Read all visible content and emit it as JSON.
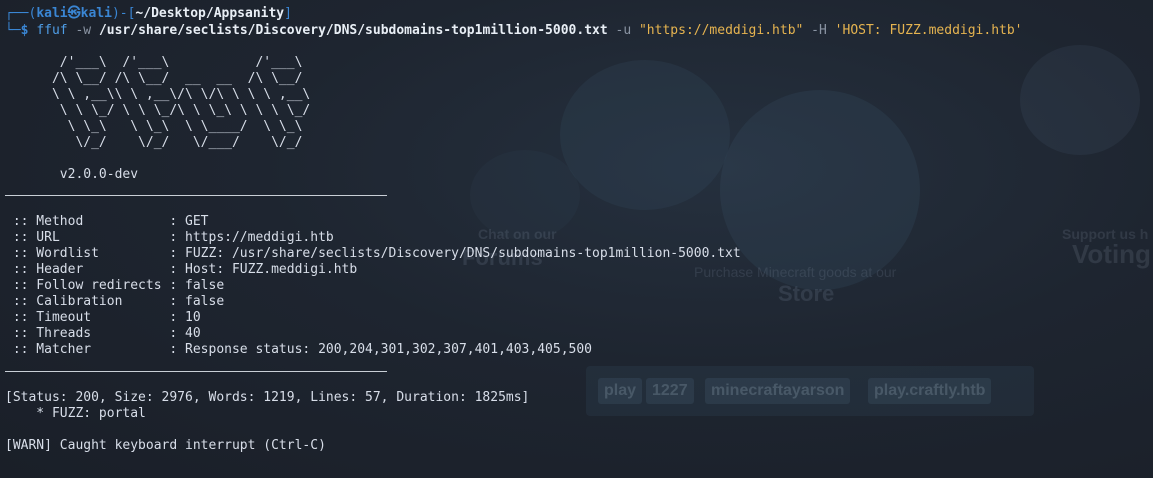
{
  "prompt": {
    "frame_top": "┌──(",
    "user": "kali㉿kali",
    "frame_mid": ")-[",
    "cwd": "~/Desktop/Appsanity",
    "frame_end": "]",
    "frame_bottom": "└─",
    "dollar": "$ "
  },
  "command": {
    "program": "ffuf",
    "flag_w": " -w ",
    "wordlist": "/usr/share/seclists/Discovery/DNS/subdomains-top1million-5000.txt",
    "flag_u": " -u ",
    "url": "\"https://meddigi.htb\"",
    "flag_h": " -H ",
    "header": "'HOST: FUZZ.meddigi.htb'"
  },
  "banner": {
    "art": [
      "       /'___\\  /'___\\           /'___\\       ",
      "      /\\ \\__/ /\\ \\__/  __  __  /\\ \\__/       ",
      "      \\ \\ ,__\\\\ \\ ,__\\/\\ \\/\\ \\ \\ \\ ,__\\      ",
      "       \\ \\ \\_/ \\ \\ \\_/\\ \\ \\_\\ \\ \\ \\ \\_/      ",
      "        \\ \\_\\   \\ \\_\\  \\ \\____/  \\ \\_\\       ",
      "         \\/_/    \\/_/   \\/___/    \\/_/       "
    ],
    "version": "       v2.0.0-dev"
  },
  "config": [
    " :: Method           : GET",
    " :: URL              : https://meddigi.htb",
    " :: Wordlist         : FUZZ: /usr/share/seclists/Discovery/DNS/subdomains-top1million-5000.txt",
    " :: Header           : Host: FUZZ.meddigi.htb",
    " :: Follow redirects : false",
    " :: Calibration      : false",
    " :: Timeout          : 10",
    " :: Threads          : 40",
    " :: Matcher          : Response status: 200,204,301,302,307,401,403,405,500"
  ],
  "result": {
    "status_line": "[Status: 200, Size: 2976, Words: 1219, Lines: 57, Duration: 1825ms]",
    "fuzz_line": "    * FUZZ: portal"
  },
  "warning": "[WARN] Caught keyboard interrupt (Ctrl-C)",
  "wallpaper": {
    "chat_text": "Chat on our",
    "forums_text": "Forums",
    "support_text": "Support us h",
    "voting_text": "Voting",
    "purchase_text": "Purchase Minecraft goods at our",
    "store_text": "Store",
    "chips": [
      "play",
      "1227",
      "minecraftayarson",
      "play.craftly.htb"
    ]
  },
  "colors": {
    "background": "#1b2029",
    "prompt_blue": "#3a86d4",
    "string_yellow": "#e6b450",
    "text": "#d8dee9"
  }
}
